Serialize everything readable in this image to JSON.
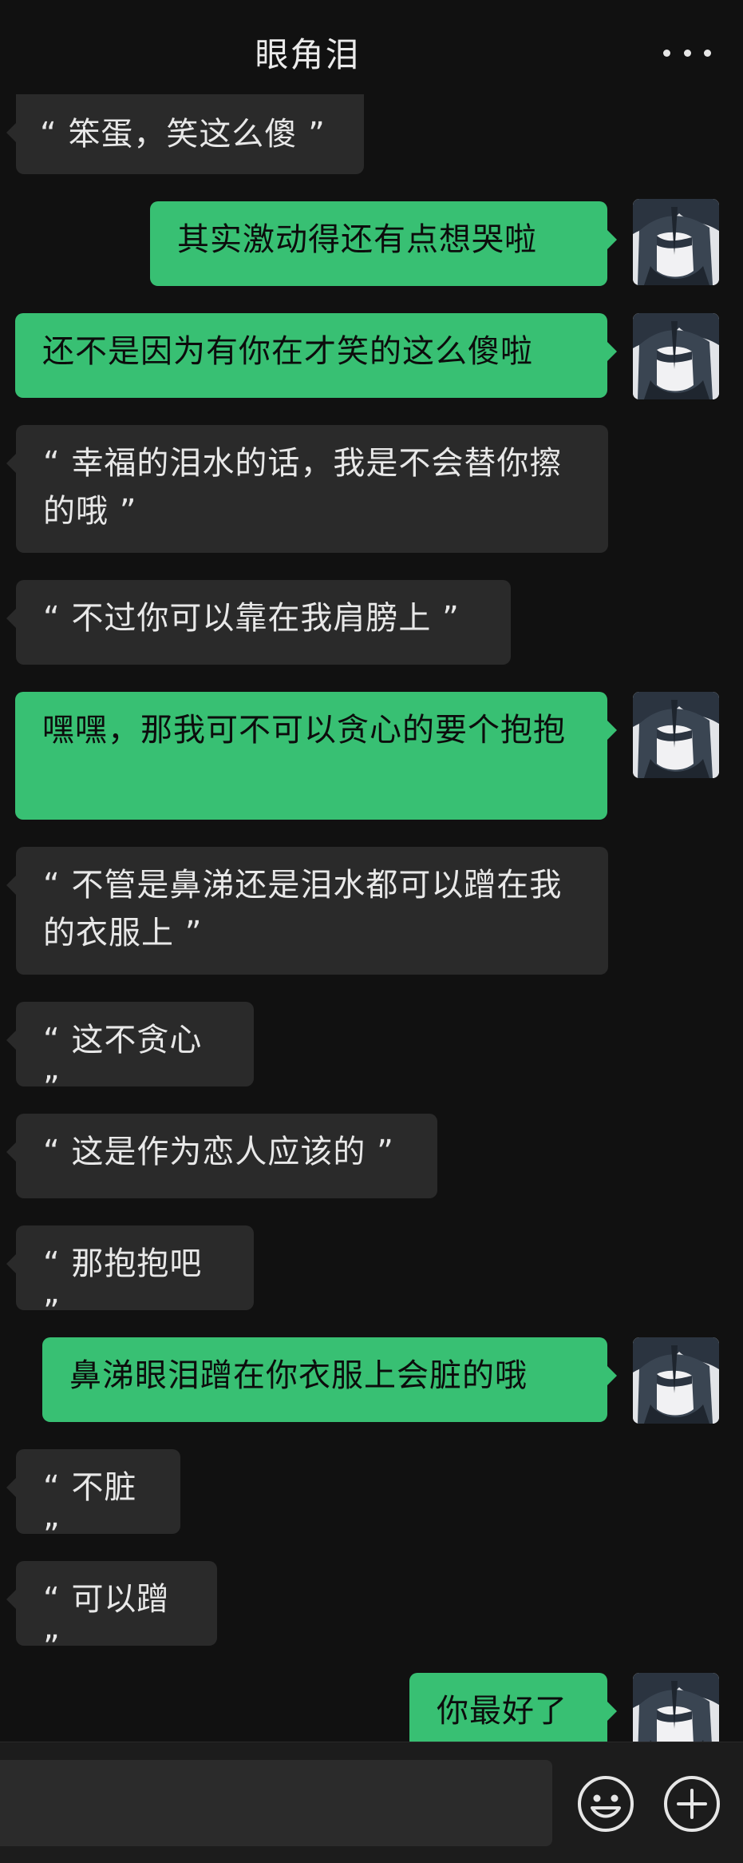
{
  "header": {
    "title": "眼角泪"
  },
  "messages": [
    {
      "side": "left",
      "text": "“ 笨蛋，笑这么傻 ”"
    },
    {
      "side": "right",
      "text": "其实激动得还有点想哭啦"
    },
    {
      "side": "right",
      "text": "还不是因为有你在才笑的这么傻啦"
    },
    {
      "side": "left",
      "text": "“ 幸福的泪水的话，我是不会替你擦的哦 ”"
    },
    {
      "side": "left",
      "text": "“ 不过你可以靠在我肩膀上 ”"
    },
    {
      "side": "right",
      "text": "嘿嘿，那我可不可以贪心的要个抱抱"
    },
    {
      "side": "left",
      "text": "“ 不管是鼻涕还是泪水都可以蹭在我的衣服上 ”"
    },
    {
      "side": "left",
      "text": "“ 这不贪心 ”"
    },
    {
      "side": "left",
      "text": "“ 这是作为恋人应该的 ”"
    },
    {
      "side": "left",
      "text": "“ 那抱抱吧 ”"
    },
    {
      "side": "right",
      "text": "鼻涕眼泪蹭在你衣服上会脏的哦"
    },
    {
      "side": "left",
      "text": "“ 不脏 ”"
    },
    {
      "side": "left",
      "text": "“ 可以蹭 ”"
    },
    {
      "side": "right",
      "text": "你最好了"
    }
  ],
  "icons": {
    "more": "more-dots-icon",
    "emoji": "emoji-smile-icon",
    "plus": "plus-circle-icon"
  },
  "colors": {
    "background": "#111111",
    "incoming_bubble": "#2a2a2a",
    "outgoing_bubble": "#38c073"
  }
}
